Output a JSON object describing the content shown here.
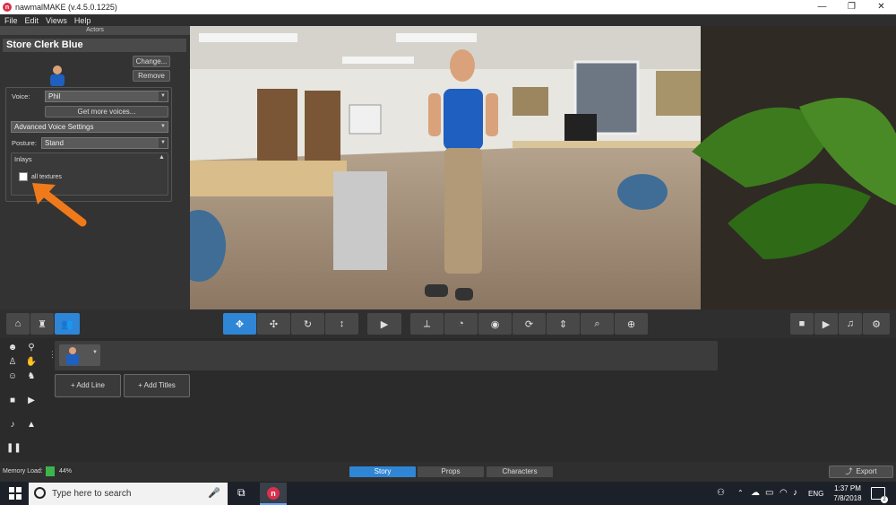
{
  "window": {
    "title": "nawmalMAKE (v.4.5.0.1225)",
    "logo_letter": "n",
    "controls": [
      "—",
      "❐",
      "✕"
    ]
  },
  "menu": [
    "File",
    "Edit",
    "Views",
    "Help"
  ],
  "actors_panel": {
    "header": "Actors",
    "actor_name": "Store Clerk Blue",
    "change_label": "Change...",
    "remove_label": "Remove",
    "voice_label": "Voice:",
    "voice_value": "Phil",
    "more_voices_label": "Get more voices...",
    "advanced_voice_label": "Advanced Voice Settings",
    "posture_label": "Posture:",
    "posture_value": "Stand",
    "inlays_label": "Inlays",
    "all_textures_label": "all textures"
  },
  "toolbar": {
    "left_icons": [
      "home-icon",
      "chair-icon",
      "people-icon"
    ],
    "camera_icons": [
      "move-icon",
      "pan-icon",
      "rotate-icon",
      "vertical-icon"
    ],
    "play_icon": "play-icon",
    "view_icons": [
      "tilt-icon",
      "angle-icon",
      "eye-icon",
      "refresh-icon",
      "compress-icon",
      "zoom-icon",
      "zoom-fit-icon"
    ],
    "right_icons": [
      "camera-icon",
      "video-icon",
      "music-icon",
      "settings-icon"
    ]
  },
  "timeline": {
    "add_line_label": "+ Add Line",
    "add_titles_label": "+ Add Titles"
  },
  "status": {
    "memory_label": "Memory Load:",
    "memory_value": "44%",
    "tabs": [
      "Story",
      "Props",
      "Characters"
    ],
    "active_tab": "Story",
    "export_label": "Export"
  },
  "taskbar": {
    "search_placeholder": "Type here to search",
    "language": "ENG",
    "time": "1:37 PM",
    "date": "7/8/2018",
    "notification_count": "2"
  },
  "colors": {
    "accent": "#2f86d6",
    "arrow": "#f07a1a",
    "memory": "#3cb44b"
  }
}
